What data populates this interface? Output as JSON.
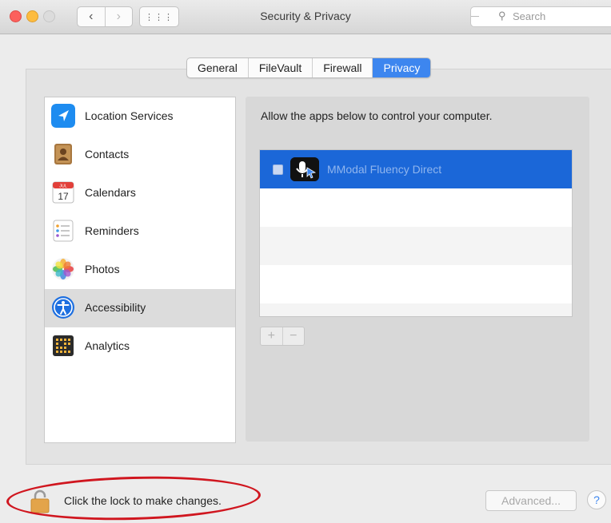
{
  "window": {
    "title": "Security & Privacy"
  },
  "toolbar": {
    "search_placeholder": "Search"
  },
  "tabs": [
    {
      "label": "General",
      "selected": false
    },
    {
      "label": "FileVault",
      "selected": false
    },
    {
      "label": "Firewall",
      "selected": false
    },
    {
      "label": "Privacy",
      "selected": true
    }
  ],
  "sidebar": {
    "items": [
      {
        "label": "Location Services",
        "icon": "location-arrow-icon",
        "selected": false
      },
      {
        "label": "Contacts",
        "icon": "contacts-book-icon",
        "selected": false
      },
      {
        "label": "Calendars",
        "icon": "calendar-icon",
        "selected": false
      },
      {
        "label": "Reminders",
        "icon": "reminders-list-icon",
        "selected": false
      },
      {
        "label": "Photos",
        "icon": "photos-flower-icon",
        "selected": false
      },
      {
        "label": "Accessibility",
        "icon": "accessibility-icon",
        "selected": true
      },
      {
        "label": "Analytics",
        "icon": "analytics-icon",
        "selected": false
      }
    ]
  },
  "calendar_icon": {
    "month": "JUL",
    "day": "17"
  },
  "main": {
    "description": "Allow the apps below to control your computer.",
    "apps": [
      {
        "name": "MModal Fluency Direct",
        "checked": false,
        "icon": "microphone-cursor-icon",
        "selected": true
      }
    ],
    "add_label": "+",
    "remove_label": "−"
  },
  "footer": {
    "lock_text": "Click the lock to make changes.",
    "advanced_label": "Advanced...",
    "help_label": "?"
  },
  "colors": {
    "accent": "#3d86ef",
    "selection": "#1b67d8",
    "annotation": "#d0161f"
  }
}
